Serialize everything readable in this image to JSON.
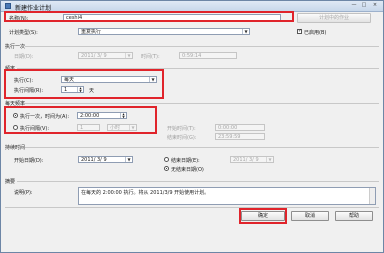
{
  "window": {
    "title": "新建作业计划",
    "controls": [
      "—",
      "□",
      "×"
    ]
  },
  "name_row": {
    "label": "名称(N):",
    "value": "ceshi4",
    "jobs_button": "计划中的作业"
  },
  "schedule_type": {
    "label": "计划类型(S):",
    "value": "重复执行",
    "enabled_label": "已启用(B)",
    "enabled": true
  },
  "once": {
    "header": "执行一次",
    "date_label": "日期(D):",
    "date_value": "2011/ 3/ 9",
    "time_label": "时间(T):",
    "time_value": "0:59:14"
  },
  "frequency": {
    "header": "频率",
    "occurs_label": "执行(C):",
    "occurs_value": "每天",
    "recurs_label": "执行间隔(R):",
    "recurs_value": "1",
    "recurs_unit": "天"
  },
  "daily_frequency": {
    "header": "每天频率",
    "once_label": "执行一次，时间为(A):",
    "once_value": "2:00:00",
    "every_label": "执行间隔(V):",
    "every_value": "1",
    "every_unit": "小时",
    "start_label": "开始时间(T):",
    "start_value": "0:00:00",
    "end_label": "结束时间(G):",
    "end_value": "23:59:59"
  },
  "duration": {
    "header": "持续时间",
    "start_label": "开始日期(D):",
    "start_value": "2011/ 3/ 9",
    "end_label": "结束日期(E):",
    "end_value": "2011/ 3/ 9",
    "noend_label": "无结束日期(O)"
  },
  "summary": {
    "header": "摘要",
    "desc_label": "说明(P):",
    "desc_value": "在每天的 2:00:00 执行。将从 2011/3/9 开始使用计划。"
  },
  "footer": {
    "ok": "确定",
    "cancel": "取消",
    "help": "帮助"
  },
  "colors": {
    "highlight": "#e0242b",
    "title_bar": "#c7d7ea"
  }
}
